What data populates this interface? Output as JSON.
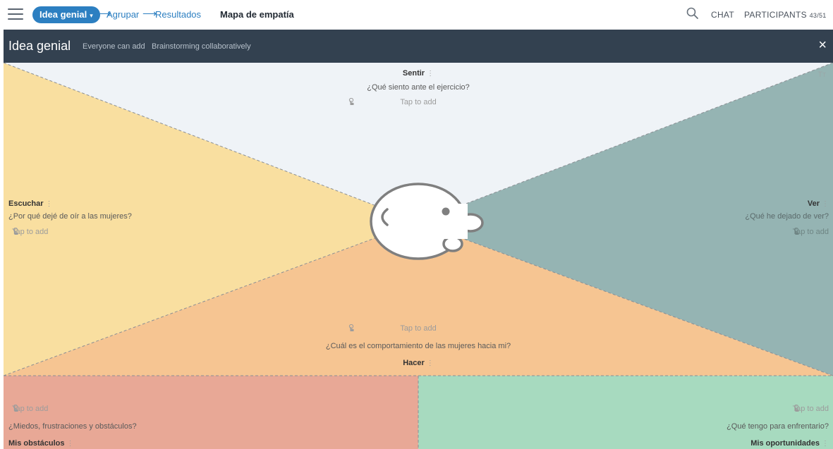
{
  "topbar": {
    "step_current": "Idea genial",
    "step_2": "Agrupar",
    "step_3": "Resultados",
    "arrow": "⟶",
    "map_title": "Mapa de empatía",
    "chat": "CHAT",
    "participants_label": "PARTICIPANTS",
    "participants_count": "43/51"
  },
  "header": {
    "title": "Idea genial",
    "permission": "Everyone can add",
    "mode": "Brainstorming collaboratively",
    "close": "×"
  },
  "sections": {
    "sentir": {
      "label": "Sentir",
      "question": "¿Qué siento ante el ejercicio?",
      "tap": "Tap to add"
    },
    "escuchar": {
      "label": "Escuchar",
      "question": "¿Por qué dejé de oír a las mujeres?",
      "tap": "Tap to add"
    },
    "ver": {
      "label": "Ver",
      "question": "¿Qué he dejado de ver?",
      "tap": "Tap to add"
    },
    "hacer": {
      "label": "Hacer",
      "question": "¿Cuál es el comportamiento de las mujeres hacia mi?",
      "tap": "Tap to add"
    },
    "obstaculos": {
      "label": "Mis obstáculos",
      "question": "¿Miedos, frustraciones y obstáculos?",
      "tap": "Tap to add"
    },
    "oportunidades": {
      "label": "Mis oportunidades",
      "question": "¿Qué tengo para enfrentario?",
      "tap": "Tap to add"
    }
  },
  "icons": [
    "menu-icon",
    "chevron-down-icon",
    "search-icon",
    "close-icon",
    "tap-hand-icon",
    "text-size-icon",
    "face-illustration"
  ],
  "colors": {
    "brand": "#2c7fc1",
    "header_bg": "#334150",
    "sentir": "#eff3f7",
    "escuchar": "#f9dfa0",
    "ver": "#95b4b3",
    "hacer": "#f6c592",
    "obstaculos": "#e8a896",
    "oportunidades": "#a7dabf"
  }
}
